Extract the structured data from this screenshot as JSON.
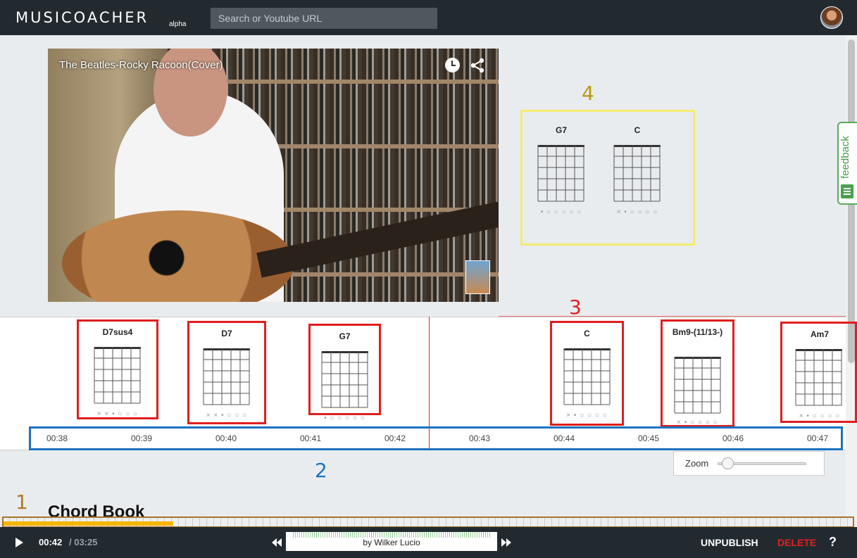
{
  "header": {
    "logo": "MUSICOACHER",
    "logo_sub": "alpha",
    "search_placeholder": "Search or Youtube URL"
  },
  "feedback_label": "feedback",
  "video": {
    "title": "The Beatles-Rocky Racoon(Cover)"
  },
  "annotations": {
    "n1": "1",
    "n2": "2",
    "n3": "3",
    "n4": "4",
    "colors": {
      "n1": "#b07a20",
      "n2": "#1a72c0",
      "n3": "#e02020",
      "n4": "#b89a10"
    }
  },
  "current_chords": [
    {
      "name": "G7",
      "markers": "• ○ ○ ○ ○ ○"
    },
    {
      "name": "C",
      "markers": "× • ○ ○ ○ ○"
    }
  ],
  "timeline_chords": [
    {
      "name": "D7sus4",
      "markers": "× × • ○ ○ ○"
    },
    {
      "name": "D7",
      "markers": "× × • ○ ○ ○"
    },
    {
      "name": "G7",
      "markers": "• ○ ○ ○ ○ ○"
    },
    {
      "name": "C",
      "markers": "× • ○ ○ ○ ○"
    },
    {
      "name": "Bm9-(11/13-)",
      "markers": "× • ○ ○ ○ ○"
    },
    {
      "name": "Am7",
      "markers": "× • ○ ○ ○ ○"
    }
  ],
  "timeline_ticks": [
    "00:38",
    "00:39",
    "00:40",
    "00:41",
    "00:42",
    "00:43",
    "00:44",
    "00:45",
    "00:46",
    "00:47"
  ],
  "zoom": {
    "label": "Zoom",
    "level": 0.05
  },
  "chord_book_title": "Chord Book",
  "player": {
    "current_time": "00:42",
    "total_time": "/ 03:25",
    "progress": 0.2,
    "author": "by Wilker Lucio",
    "unpublish_label": "UNPUBLISH",
    "delete_label": "DELETE",
    "help_label": "?"
  }
}
